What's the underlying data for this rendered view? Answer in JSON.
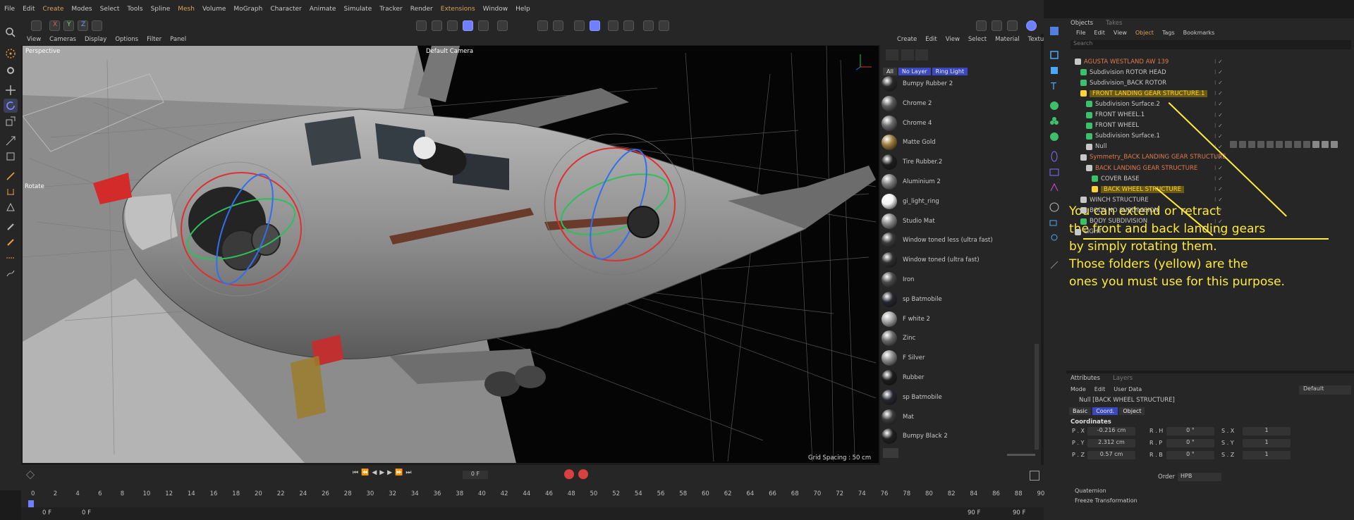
{
  "menu": [
    "File",
    "Edit",
    "Create",
    "Modes",
    "Select",
    "Tools",
    "Spline",
    "Mesh",
    "Volume",
    "MoGraph",
    "Character",
    "Animate",
    "Simulate",
    "Tracker",
    "Render",
    "Extensions",
    "Window",
    "Help"
  ],
  "viewport_menu": [
    "View",
    "Cameras",
    "Display",
    "Options",
    "Filter",
    "Panel"
  ],
  "viewport": {
    "mode": "Perspective",
    "camera": "Default Camera",
    "tool": "Rotate",
    "grid": "Grid Spacing : 50 cm"
  },
  "material_menu": [
    "Create",
    "Edit",
    "View",
    "Select",
    "Material",
    "Texture"
  ],
  "material_filters": [
    "All",
    "No Layer",
    "Ring Light"
  ],
  "materials": [
    {
      "name": "Bumpy Rubber 2",
      "color": "#2a2a2a"
    },
    {
      "name": "Chrome 2",
      "color": "#5c5c5c"
    },
    {
      "name": "Chrome 4",
      "color": "#6b6b6b"
    },
    {
      "name": "Matte Gold",
      "color": "#9a7b3b"
    },
    {
      "name": "Tire Rubber.2",
      "color": "#1e1e1e"
    },
    {
      "name": "Aluminium 2",
      "color": "#7d7d7d"
    },
    {
      "name": "gi_light_ring",
      "color": "#f5f5f5"
    },
    {
      "name": "Studio Mat",
      "color": "#888888"
    },
    {
      "name": "Window toned less (ultra fast)",
      "color": "#3a3a3a"
    },
    {
      "name": "Window toned (ultra fast)",
      "color": "#2f2f2f"
    },
    {
      "name": "Iron",
      "color": "#4a4a4a"
    },
    {
      "name": "sp Batmobile",
      "color": "#262630"
    },
    {
      "name": "F white 2",
      "color": "#a5a5a5"
    },
    {
      "name": "Zinc",
      "color": "#6a6a6a"
    },
    {
      "name": "F Silver",
      "color": "#8a8a8a"
    },
    {
      "name": "Rubber",
      "color": "#1c1c1c"
    },
    {
      "name": "sp Batmobile",
      "color": "#262630"
    },
    {
      "name": "Mat",
      "color": "#3b3b3b"
    },
    {
      "name": "Bumpy Black 2",
      "color": "#202020"
    }
  ],
  "objects_tabs": [
    "Objects",
    "Takes"
  ],
  "objects_menu": [
    "File",
    "Edit",
    "View",
    "Object",
    "Tags",
    "Bookmarks"
  ],
  "search_placeholder": "Search",
  "objects": [
    {
      "name": "AGUSTA WESTLAND AW 139",
      "indent": 0,
      "color": "#e07a4a"
    },
    {
      "name": "Subdivision ROTOR HEAD",
      "indent": 1,
      "color": "#c8c8c8"
    },
    {
      "name": "Subdivision_BACK ROTOR",
      "indent": 1,
      "color": "#c8c8c8"
    },
    {
      "name": "FRONT LANDING GEAR STRUCTURE.1",
      "indent": 1,
      "color": "#ffd23a"
    },
    {
      "name": "Subdivision Surface.2",
      "indent": 2,
      "color": "#c8c8c8"
    },
    {
      "name": "FRONT WHEEL.1",
      "indent": 2,
      "color": "#c8c8c8"
    },
    {
      "name": "FRONT WHEEL",
      "indent": 2,
      "color": "#c8c8c8"
    },
    {
      "name": "Subdivision Surface.1",
      "indent": 2,
      "color": "#c8c8c8"
    },
    {
      "name": "Null",
      "indent": 2,
      "color": "#c8c8c8"
    },
    {
      "name": "Symmetry_BACK LANDING GEAR STRUCTURE",
      "indent": 1,
      "color": "#e07a4a"
    },
    {
      "name": "BACK LANDING GEAR STRUCTURE",
      "indent": 2,
      "color": "#e07a4a"
    },
    {
      "name": "COVER BASE",
      "indent": 3,
      "color": "#c8c8c8"
    },
    {
      "name": "BACK WHEEL STRUCTURE",
      "indent": 3,
      "color": "#ffd23a"
    },
    {
      "name": "WINCH STRUCTURE",
      "indent": 1,
      "color": "#c8c8c8"
    },
    {
      "name": "BODY NO SUBDIVISION",
      "indent": 1,
      "color": "#c8c8c8"
    },
    {
      "name": "BODY SUBDIVISION",
      "indent": 1,
      "color": "#c8c8c8"
    },
    {
      "name": "LIGHT",
      "indent": 0,
      "color": "#c8c8c8"
    }
  ],
  "annotation": [
    "You can extend or retract",
    "the front and back landing gears",
    "by simply rotating them.",
    "Those folders (yellow) are the",
    "ones you must use for this purpose."
  ],
  "attributes": {
    "tabs": [
      "Attributes",
      "Layers"
    ],
    "menu": [
      "Mode",
      "Edit",
      "User Data"
    ],
    "preset": "Default",
    "object_label": "Null [BACK WHEEL STRUCTURE]",
    "subtabs": [
      "Basic",
      "Coord.",
      "Object"
    ],
    "section": "Coordinates",
    "fields": [
      {
        "label": "P . X",
        "value": "-0.216 cm",
        "label2": "R . H",
        "value2": "0 °",
        "label3": "S . X",
        "value3": "1"
      },
      {
        "label": "P . Y",
        "value": "2.312 cm",
        "label2": "R . P",
        "value2": "0 °",
        "label3": "S . Y",
        "value3": "1"
      },
      {
        "label": "P . Z",
        "value": "0.57 cm",
        "label2": "R . B",
        "value2": "0 °",
        "label3": "S . Z",
        "value3": "1"
      }
    ],
    "order_label": "Order",
    "order_value": "HPB",
    "collapsed": [
      "Quaternion",
      "Freeze Transformation"
    ]
  },
  "timeline": {
    "frame_field": "0 F",
    "ticks": [
      "0",
      "2",
      "4",
      "6",
      "8",
      "10",
      "12",
      "14",
      "16",
      "18",
      "20",
      "22",
      "24",
      "26",
      "28",
      "30",
      "32",
      "34",
      "36",
      "38",
      "40",
      "42",
      "44",
      "46",
      "48",
      "50",
      "52",
      "54",
      "56",
      "58",
      "60",
      "62",
      "64",
      "66",
      "68",
      "70",
      "72",
      "74",
      "76",
      "78",
      "80",
      "82",
      "84",
      "86",
      "88",
      "90"
    ],
    "start_a": "0 F",
    "start_b": "0 F",
    "end_a": "90 F",
    "end_b": "90 F"
  }
}
